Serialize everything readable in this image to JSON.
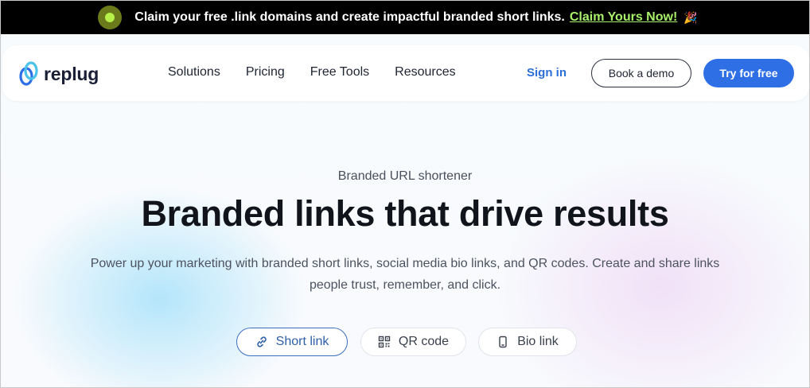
{
  "promo": {
    "text": "Claim your free .link domains and create impactful branded short links.",
    "link": "Claim Yours Now!",
    "emoji": "🎉"
  },
  "nav": {
    "logo_text": "replug",
    "menu": [
      "Solutions",
      "Pricing",
      "Free Tools",
      "Resources"
    ],
    "signin": "Sign in",
    "demo": "Book a demo",
    "try": "Try for free"
  },
  "hero": {
    "eyebrow": "Branded URL shortener",
    "headline": "Branded links that drive results",
    "subtext": "Power up your marketing with branded short links, social media bio links, and QR codes. Create and share links people trust, remember, and click.",
    "tabs": [
      {
        "label": "Short link",
        "icon": "link-icon",
        "active": true
      },
      {
        "label": "QR code",
        "icon": "qr-code-icon",
        "active": false
      },
      {
        "label": "Bio link",
        "icon": "mobile-icon",
        "active": false
      }
    ]
  },
  "colors": {
    "primary": "#2f6fe6",
    "promo_bg": "#000000",
    "promo_link": "#a8f06a",
    "headline": "#12141c"
  }
}
